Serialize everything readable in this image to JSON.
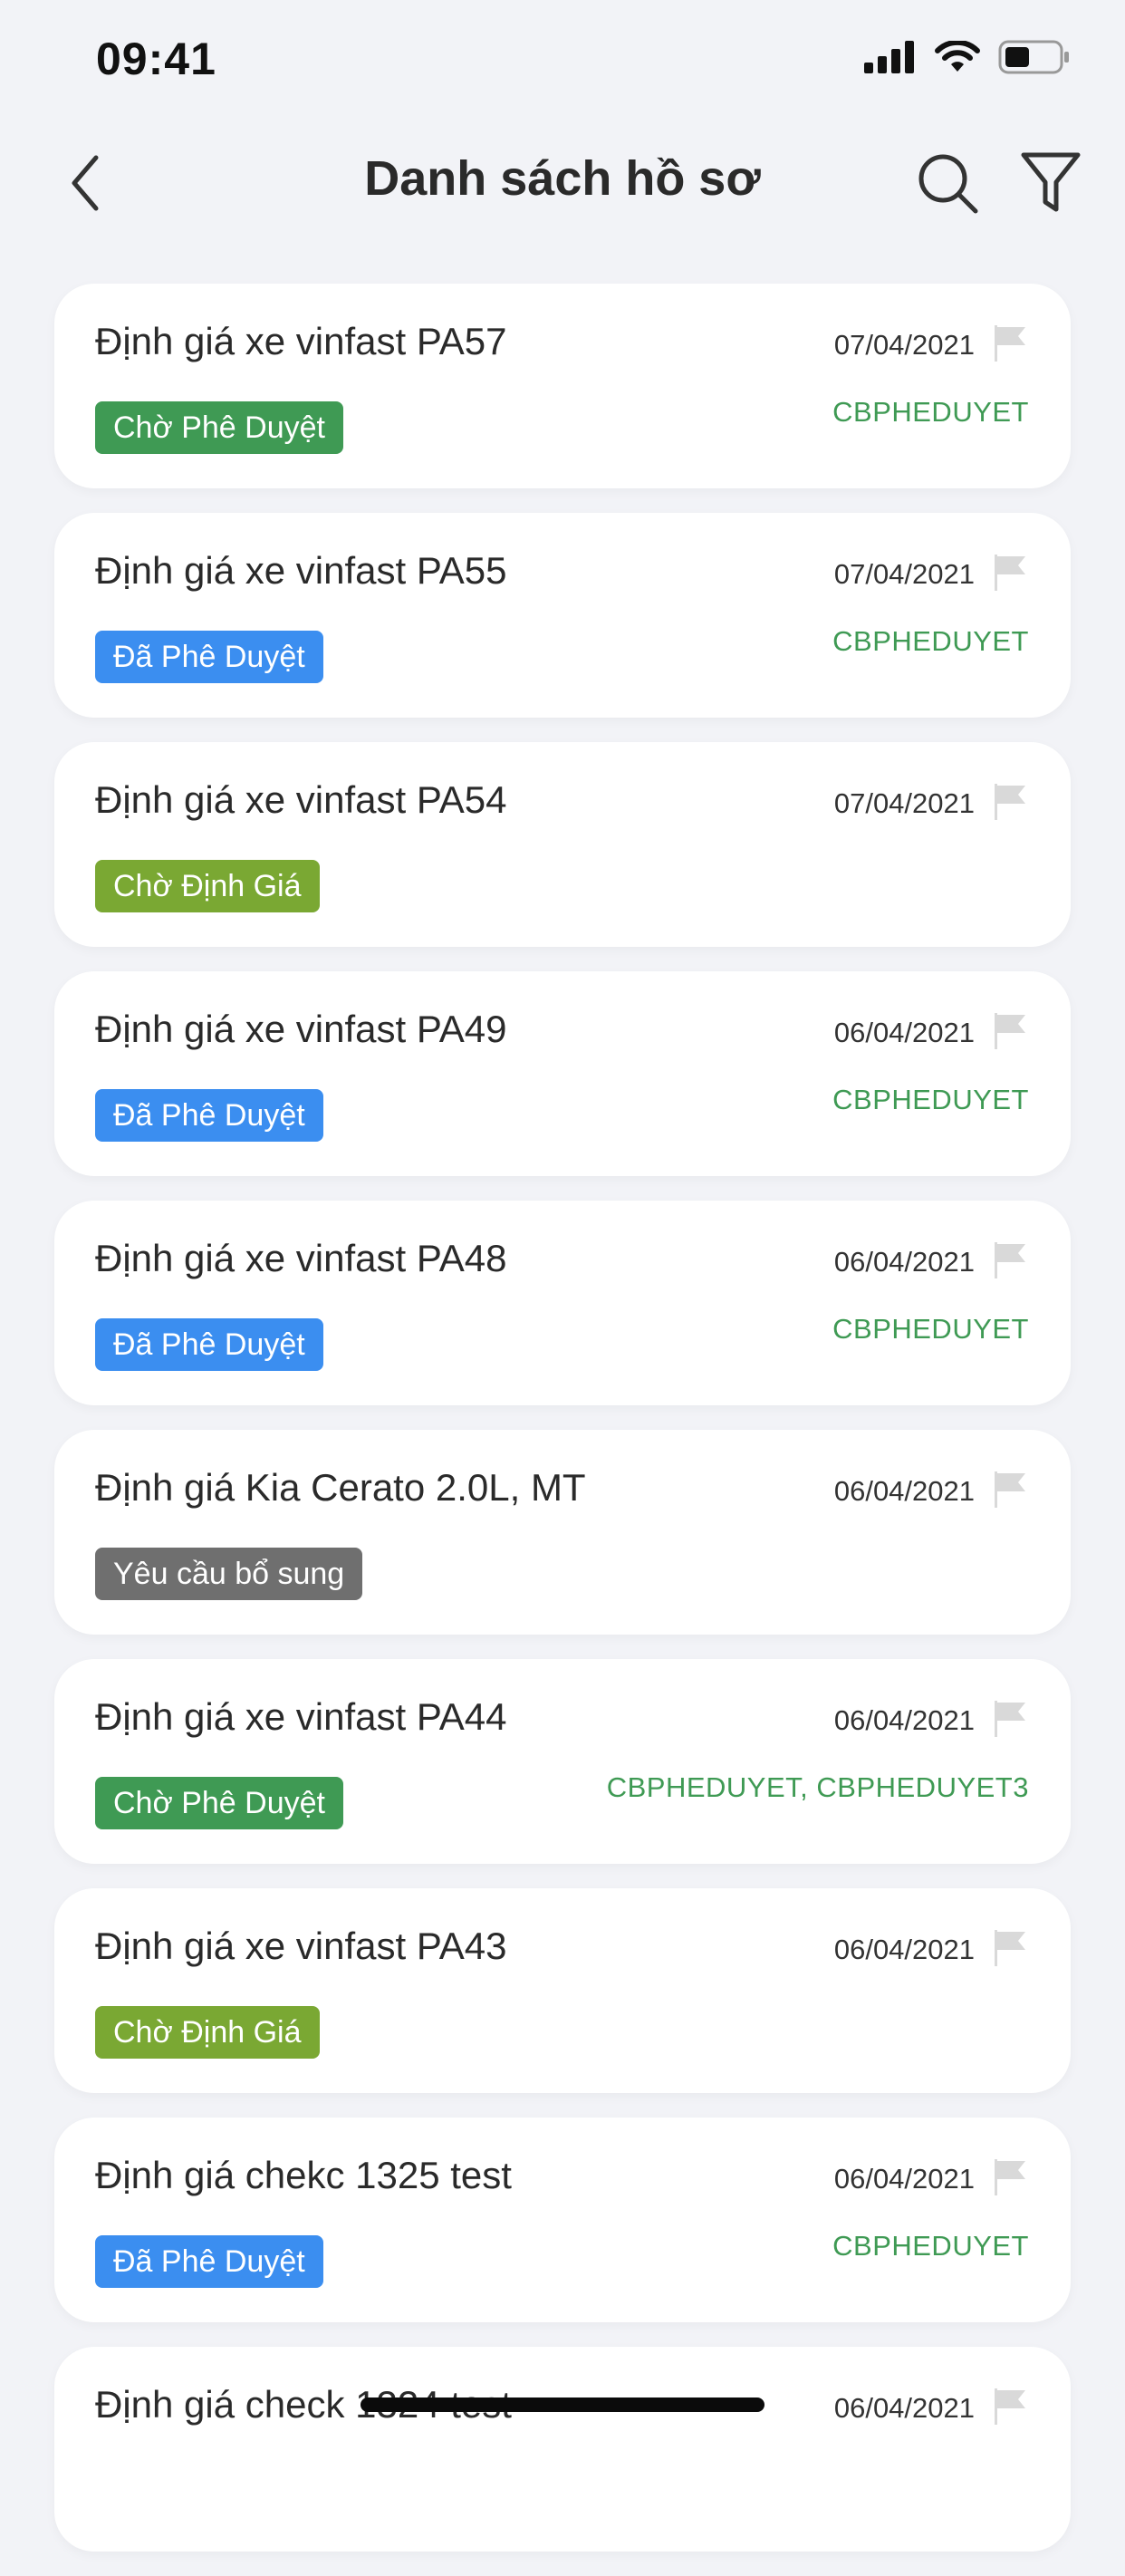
{
  "status_bar": {
    "time": "09:41"
  },
  "header": {
    "title": "Danh sách hồ sơ",
    "back_icon": "chevron-left-icon",
    "search_icon": "search-icon",
    "filter_icon": "filter-icon"
  },
  "colors": {
    "background": "#f2f3f7",
    "card": "#ffffff",
    "badge_cho_phe_duyet": "#3f9a54",
    "badge_da_phe_duyet": "#3b8ef0",
    "badge_cho_dinh_gia": "#7aa833",
    "badge_yeu_cau_bo_sung": "#6f6f6f",
    "assignee_text": "#3f9a54",
    "flag": "#d9d9d9"
  },
  "records": [
    {
      "title": "Định giá xe vinfast PA57",
      "date": "07/04/2021",
      "status": "Chờ Phê Duyệt",
      "status_color": "#3f9a54",
      "assignee": "CBPHEDUYET"
    },
    {
      "title": "Định giá xe vinfast PA55",
      "date": "07/04/2021",
      "status": "Đã Phê Duyệt",
      "status_color": "#3b8ef0",
      "assignee": "CBPHEDUYET"
    },
    {
      "title": "Định giá xe vinfast PA54",
      "date": "07/04/2021",
      "status": "Chờ Định Giá",
      "status_color": "#7aa833",
      "assignee": ""
    },
    {
      "title": "Định giá xe vinfast PA49",
      "date": "06/04/2021",
      "status": "Đã Phê Duyệt",
      "status_color": "#3b8ef0",
      "assignee": "CBPHEDUYET"
    },
    {
      "title": "Định giá xe vinfast PA48",
      "date": "06/04/2021",
      "status": "Đã Phê Duyệt",
      "status_color": "#3b8ef0",
      "assignee": "CBPHEDUYET"
    },
    {
      "title": "Định giá Kia Cerato 2.0L, MT",
      "date": "06/04/2021",
      "status": "Yêu cầu bổ sung",
      "status_color": "#6f6f6f",
      "assignee": ""
    },
    {
      "title": "Định giá xe vinfast PA44",
      "date": "06/04/2021",
      "status": "Chờ Phê Duyệt",
      "status_color": "#3f9a54",
      "assignee": "CBPHEDUYET, CBPHEDUYET3"
    },
    {
      "title": "Định giá xe vinfast PA43",
      "date": "06/04/2021",
      "status": "Chờ Định Giá",
      "status_color": "#7aa833",
      "assignee": ""
    },
    {
      "title": "Định giá chekc 1325 test",
      "date": "06/04/2021",
      "status": "Đã Phê Duyệt",
      "status_color": "#3b8ef0",
      "assignee": "CBPHEDUYET"
    },
    {
      "title": "Định giá check 1324 test",
      "date": "06/04/2021",
      "status": "",
      "status_color": "#3b8ef0",
      "assignee": ""
    }
  ]
}
